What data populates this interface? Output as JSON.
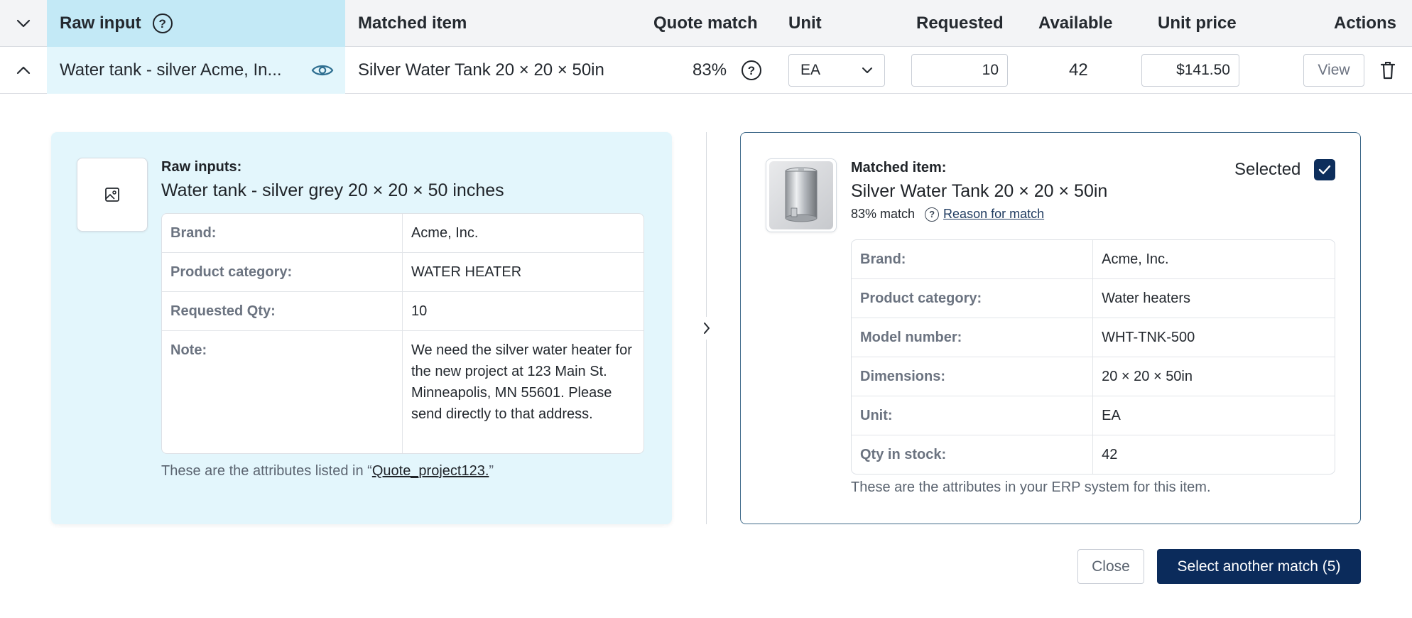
{
  "header": {
    "raw_input": "Raw input",
    "matched_item": "Matched item",
    "quote_match": "Quote match",
    "unit": "Unit",
    "requested": "Requested",
    "available": "Available",
    "unit_price": "Unit price",
    "actions": "Actions"
  },
  "row": {
    "raw_input": "Water tank - silver Acme, In...",
    "matched_item": "Silver Water Tank 20 × 20 × 50in",
    "quote_match": "83%",
    "unit": "EA",
    "requested": "10",
    "available": "42",
    "unit_price": "$141.50",
    "view_label": "View"
  },
  "left": {
    "label": "Raw inputs:",
    "title": "Water tank - silver grey 20 × 20 × 50 inches",
    "attributes": [
      {
        "key": "Brand:",
        "value": "Acme, Inc."
      },
      {
        "key": "Product category:",
        "value": "WATER HEATER"
      },
      {
        "key": "Requested Qty:",
        "value": "10"
      },
      {
        "key": "Note:",
        "value": "We need the silver water heater for the new project at 123 Main St. Minneapolis, MN 55601. Please send directly to that address."
      }
    ],
    "footnote_prefix": "These are the attributes listed in “",
    "footnote_link": "Quote_project123.",
    "footnote_suffix": "”"
  },
  "right": {
    "label": "Matched item:",
    "title": "Silver Water Tank 20 × 20 × 50in",
    "match_text": "83% match",
    "reason_link": "Reason for match",
    "selected_label": "Selected",
    "attributes": [
      {
        "key": "Brand:",
        "value": "Acme, Inc."
      },
      {
        "key": "Product category:",
        "value": "Water heaters"
      },
      {
        "key": "Model number:",
        "value": "WHT-TNK-500"
      },
      {
        "key": "Dimensions:",
        "value": "20 × 20 × 50in"
      },
      {
        "key": "Unit:",
        "value": "EA"
      },
      {
        "key": "Qty in stock:",
        "value": "42"
      }
    ],
    "footnote": "These are the attributes in your ERP system for this item."
  },
  "buttons": {
    "close": "Close",
    "select_another": "Select another match (5)"
  },
  "colors": {
    "raw_header_bg": "#c3e9f6",
    "raw_panel_bg": "#e3f6fc",
    "primary": "#0b2b5b",
    "selected_border": "#3f6a8a"
  }
}
